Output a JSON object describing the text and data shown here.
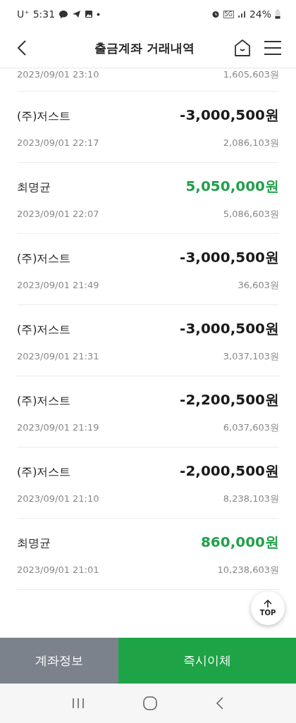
{
  "status_bar": {
    "carrier": "U⁺",
    "time": "5:31",
    "network": "5G",
    "battery": "24%"
  },
  "header": {
    "title": "출금계좌 거래내역"
  },
  "transactions": [
    {
      "kind": "partial",
      "date": "2023/09/01  23:10",
      "balance": "1,605,603원"
    },
    {
      "kind": "withdrawal",
      "name": "(주)저스트",
      "amount": "-3,000,500원",
      "date": "2023/09/01  22:17",
      "balance": "2,086,103원"
    },
    {
      "kind": "deposit",
      "name": "최명균",
      "amount": "5,050,000원",
      "date": "2023/09/01  22:07",
      "balance": "5,086,603원"
    },
    {
      "kind": "withdrawal",
      "name": "(주)저스트",
      "amount": "-3,000,500원",
      "date": "2023/09/01  21:49",
      "balance": "36,603원"
    },
    {
      "kind": "withdrawal",
      "name": "(주)저스트",
      "amount": "-3,000,500원",
      "date": "2023/09/01  21:31",
      "balance": "3,037,103원"
    },
    {
      "kind": "withdrawal",
      "name": "(주)저스트",
      "amount": "-2,200,500원",
      "date": "2023/09/01  21:19",
      "balance": "6,037,603원"
    },
    {
      "kind": "withdrawal",
      "name": "(주)저스트",
      "amount": "-2,000,500원",
      "date": "2023/09/01  21:10",
      "balance": "8,238,103원"
    },
    {
      "kind": "deposit",
      "name": "최명균",
      "amount": "860,000원",
      "date": "2023/09/01  21:01",
      "balance": "10,238,603원"
    }
  ],
  "top_button": "TOP",
  "bottom_buttons": [
    {
      "label": "계좌정보",
      "kind": "secondary"
    },
    {
      "label": "즉시이체",
      "kind": "primary"
    }
  ]
}
